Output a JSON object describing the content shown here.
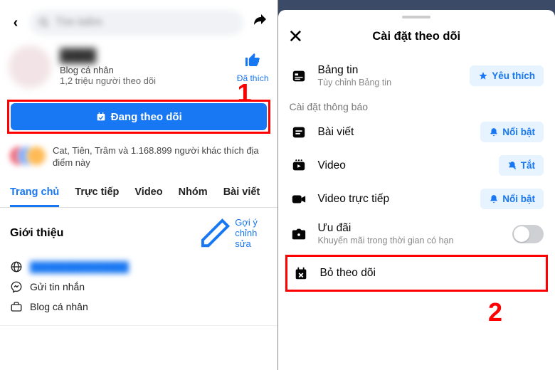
{
  "step_marker_1": "1",
  "step_marker_2": "2",
  "left": {
    "search_placeholder": "Tìm kiếm",
    "profile_name": "████",
    "bio": "Blog cá nhân",
    "followers": "1,2 triệu người theo dõi",
    "liked_label": "Đã thích",
    "follow_button": "Đang theo dõi",
    "social_text": "Cat, Tiên, Trâm và 1.168.899 người khác thích địa điểm này",
    "tabs": [
      "Trang chủ",
      "Trực tiếp",
      "Video",
      "Nhóm",
      "Bài viết"
    ],
    "about_header": "Giới thiệu",
    "suggest_edit": "Gợi ý chỉnh sửa",
    "about_link": "██████████████",
    "about_msg": "Gửi tin nhắn",
    "about_blog": "Blog cá nhân"
  },
  "right": {
    "title": "Cài đặt theo dõi",
    "newsfeed_label": "Bảng tin",
    "newsfeed_sub": "Tùy chỉnh Bảng tin",
    "favorite_btn": "Yêu thích",
    "notif_header": "Cài đặt thông báo",
    "posts_label": "Bài viết",
    "posts_btn": "Nổi bật",
    "video_label": "Video",
    "video_btn": "Tắt",
    "live_label": "Video trực tiếp",
    "live_btn": "Nổi bật",
    "offers_label": "Ưu đãi",
    "offers_sub": "Khuyến mãi trong thời gian có hạn",
    "unfollow_label": "Bỏ theo dõi"
  }
}
